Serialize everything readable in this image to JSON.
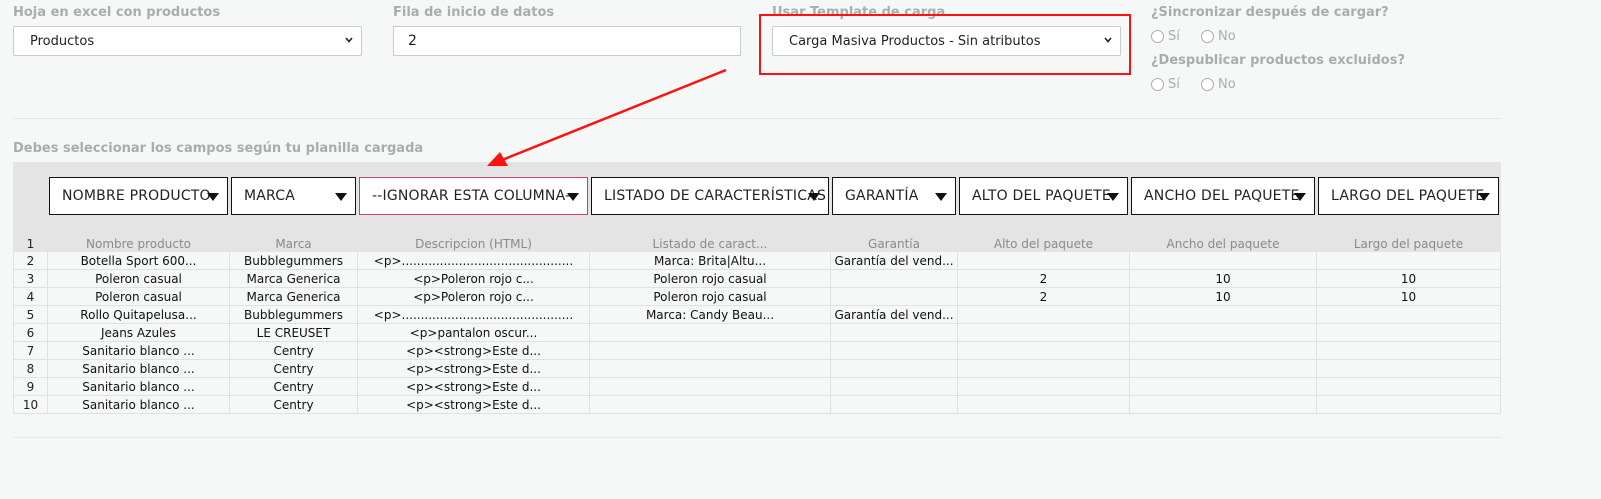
{
  "form": {
    "sheet_label": "Hoja en excel con productos",
    "sheet_value": "Productos",
    "start_row_label": "Fila de inicio de datos",
    "start_row_value": "2",
    "template_label": "Usar Template de carga",
    "template_value": "Carga Masiva Productos - Sin atributos",
    "sync_label": "¿Sincronizar después de cargar?",
    "unpublish_label": "¿Despublicar productos excluidos?",
    "yes": "Sí",
    "no": "No"
  },
  "section_label": "Debes seleccionar los campos según tu planilla cargada",
  "field_selects": [
    "NOMBRE PRODUCTO",
    "MARCA",
    "--IGNORAR ESTA COLUMNA--",
    "LISTADO DE CARACTERÍSTICAS",
    "GARANTÍA",
    "ALTO DEL PAQUETE",
    "ANCHO DEL PAQUETE",
    "LARGO DEL PAQUETE"
  ],
  "column_names": [
    "Nombre producto",
    "Marca",
    "Descripcion (HTML)",
    "Listado de caract...",
    "Garantía",
    "Alto del paquete",
    "Ancho del paquete",
    "Largo del paquete"
  ],
  "rows": [
    [
      "2",
      "Botella Sport 600...",
      "Bubblegummers",
      "<p>.............................................",
      "Marca: Brita|Altu...",
      "Garantía del vend...",
      "",
      "",
      ""
    ],
    [
      "3",
      "Poleron casual",
      "Marca Generica",
      "<p>Poleron rojo c...",
      "Poleron rojo casual",
      "",
      "2",
      "10",
      "10"
    ],
    [
      "4",
      "Poleron casual",
      "Marca Generica",
      "<p>Poleron rojo c...",
      "Poleron rojo casual",
      "",
      "2",
      "10",
      "10"
    ],
    [
      "5",
      "Rollo Quitapelusa...",
      "Bubblegummers",
      "<p>.............................................",
      "Marca: Candy Beau...",
      "Garantía del vend...",
      "",
      "",
      ""
    ],
    [
      "6",
      "Jeans Azules",
      "LE CREUSET",
      "<p>pantalon oscur...",
      "",
      "",
      "",
      "",
      ""
    ],
    [
      "7",
      "Sanitario blanco ...",
      "Centry",
      "<p><strong>Este d...",
      "",
      "",
      "",
      "",
      ""
    ],
    [
      "8",
      "Sanitario blanco ...",
      "Centry",
      "<p><strong>Este d...",
      "",
      "",
      "",
      "",
      ""
    ],
    [
      "9",
      "Sanitario blanco ...",
      "Centry",
      "<p><strong>Este d...",
      "",
      "",
      "",
      "",
      ""
    ],
    [
      "10",
      "Sanitario blanco ...",
      "Centry",
      "<p><strong>Este d...",
      "",
      "",
      "",
      "",
      ""
    ]
  ],
  "header_row_number": "1",
  "highlight_color": "#ff1111"
}
